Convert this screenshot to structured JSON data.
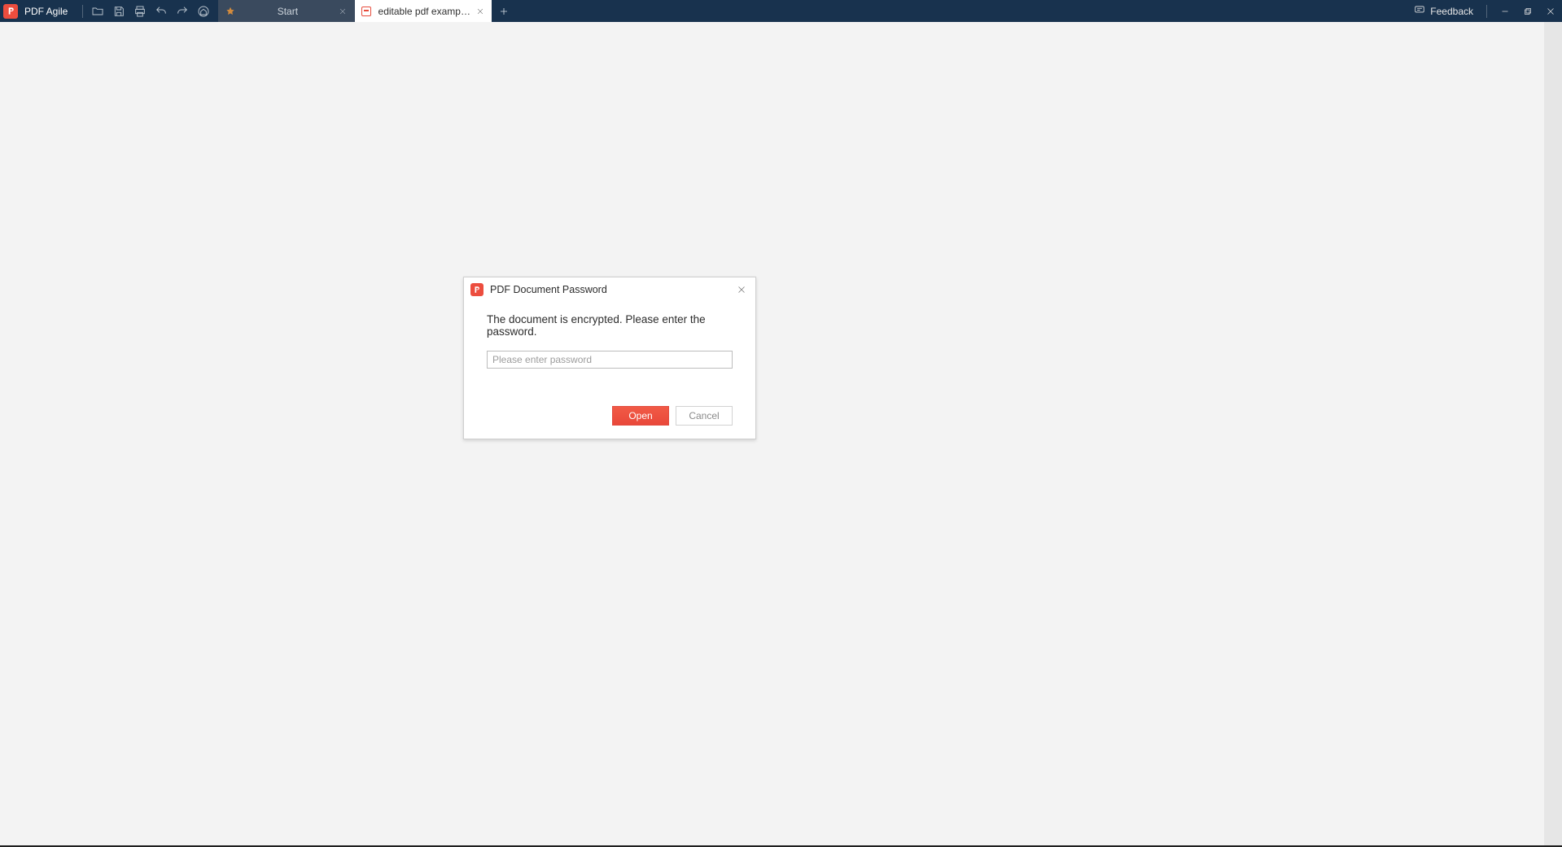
{
  "app": {
    "name": "PDF Agile"
  },
  "titlebar": {
    "feedback_label": "Feedback"
  },
  "tabs": [
    {
      "label": "Start",
      "active": false
    },
    {
      "label": "editable pdf example.pdf",
      "active": true
    }
  ],
  "modal": {
    "title": "PDF Document Password",
    "message": "The document is encrypted. Please enter the password.",
    "password_placeholder": "Please enter password",
    "password_value": "",
    "open_label": "Open",
    "cancel_label": "Cancel"
  }
}
